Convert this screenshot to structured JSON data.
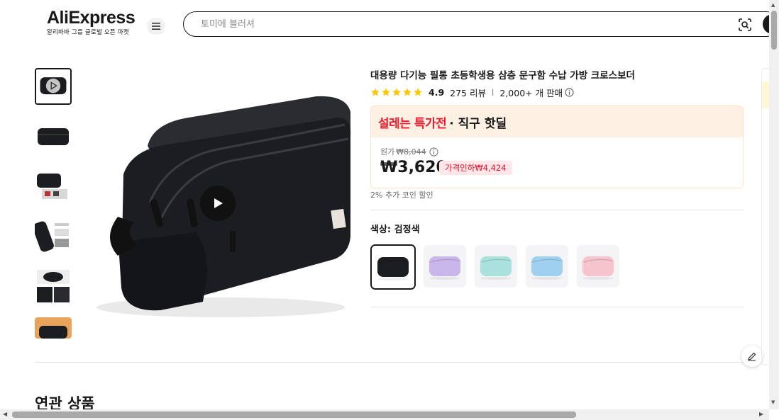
{
  "header": {
    "logo_text": "AliExpress",
    "logo_subtitle": "알리바바 그룹 글로벌 오픈 마켓",
    "search_placeholder": "토미에 블러셔"
  },
  "product": {
    "title": "대용량 다기능 필통 초등학생용 삼층 문구함 수납 가방 크로스보더",
    "rating": "4.9",
    "reviews": "275 리뷰",
    "sold": "2,000+ 개 판매",
    "deal_highlight": "설레는 특가전",
    "deal_suffix": "· 직구 핫딜",
    "original_label": "원가",
    "original_price": "₩8,044",
    "price": "₩3,620",
    "discount_badge": "가격인하₩4,424",
    "coin_note": "2% 추가 코인 할인",
    "color_label": "색상: 검정색",
    "colors": [
      {
        "name": "black",
        "hex": "#1c1d21",
        "selected": true
      },
      {
        "name": "purple",
        "hex": "#c9b6ea"
      },
      {
        "name": "mint",
        "hex": "#a9e2dc"
      },
      {
        "name": "blue",
        "hex": "#9fd0f0"
      },
      {
        "name": "pink",
        "hex": "#f5c4cc"
      }
    ]
  },
  "sections": {
    "related": "연관 상품"
  },
  "colors": {
    "accent_red": "#f01b2c",
    "deal_bg": "#fff0e4",
    "star": "#fdc700"
  }
}
